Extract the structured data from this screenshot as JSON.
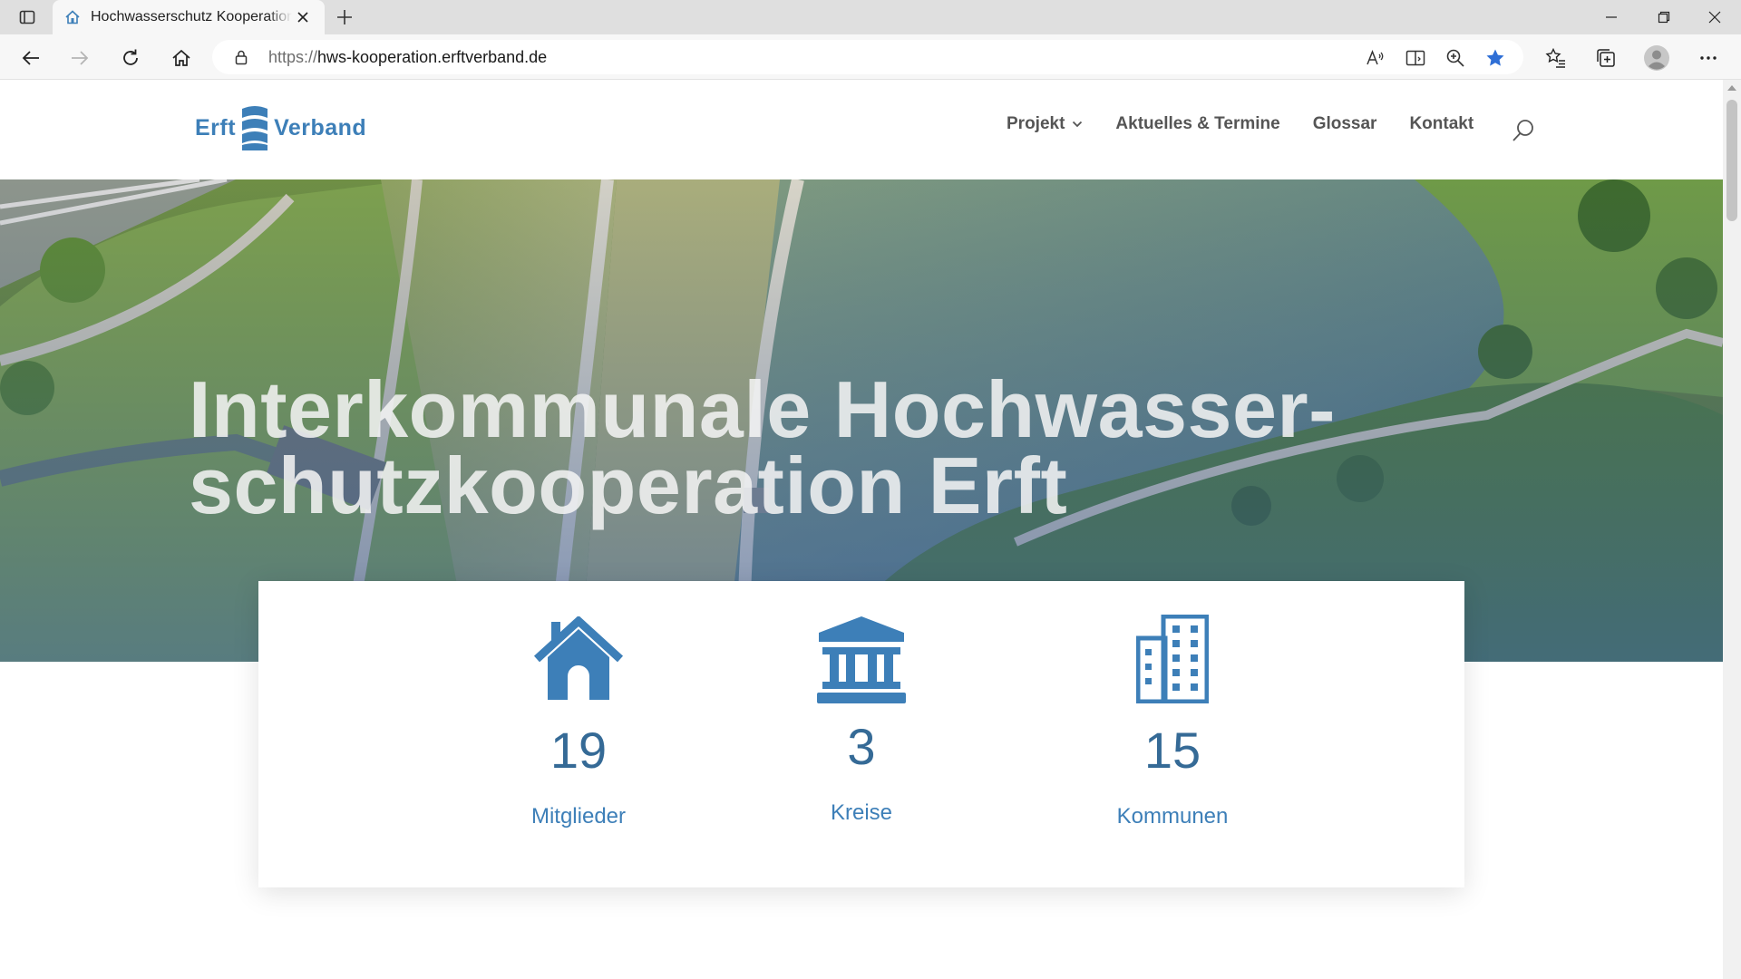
{
  "browser": {
    "tab_title": "Hochwasserschutz Kooperation Erft",
    "url_scheme": "https://",
    "url_host": "hws-kooperation.erftverband.de"
  },
  "site": {
    "logo_left": "Erft",
    "logo_right": "Verband",
    "nav": [
      "Projekt",
      "Aktuelles & Termine",
      "Glossar",
      "Kontakt"
    ]
  },
  "hero": {
    "title_line1": "Interkommunale Hochwasser-",
    "title_line2": "schutzkooperation Erft"
  },
  "stats": [
    {
      "icon": "house-icon",
      "value": "19",
      "label": "Mitglieder"
    },
    {
      "icon": "government-building-icon",
      "value": "3",
      "label": "Kreise"
    },
    {
      "icon": "office-building-icon",
      "value": "15",
      "label": "Kommunen"
    }
  ],
  "colors": {
    "brand_blue": "#3d7fb8",
    "value_blue": "#356a96",
    "nav_text": "#555555"
  }
}
